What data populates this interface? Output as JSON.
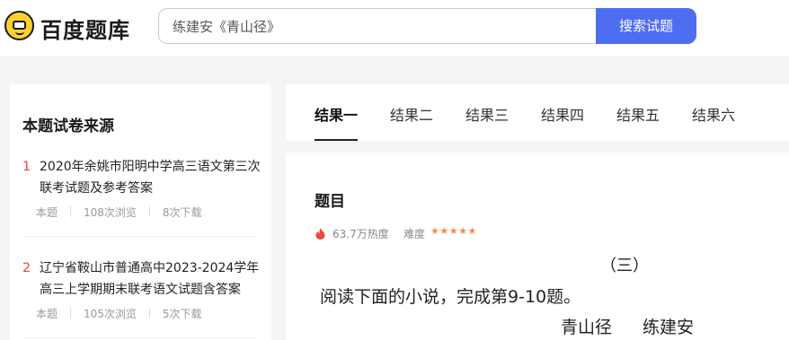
{
  "header": {
    "logo_text": "百度题库",
    "search_value": "练建安《青山径》",
    "search_button": "搜索试题"
  },
  "sidebar": {
    "title": "本题试卷来源",
    "items": [
      {
        "num": "1",
        "title": "2020年余姚市阳明中学高三语文第三次联考试题及参考答案",
        "tag": "本题",
        "views": "108次浏览",
        "downloads": "8次下载"
      },
      {
        "num": "2",
        "title": "辽宁省鞍山市普通高中2023-2024学年高三上学期期末联考语文试题含答案",
        "tag": "本题",
        "views": "105次浏览",
        "downloads": "5次下载"
      }
    ]
  },
  "tabs": [
    "结果一",
    "结果二",
    "结果三",
    "结果四",
    "结果五",
    "结果六"
  ],
  "question": {
    "heading": "题目",
    "heat": "63.7万热度",
    "difficulty_label": "难度",
    "stars": "★★★★★",
    "difficulty_stars": 5,
    "section": "（三）",
    "instruction": "阅读下面的小说，完成第9-10题。",
    "story_title": "青山径",
    "author": "练建安"
  },
  "colors": {
    "accent": "#4e6ef2",
    "number_red": "#e0473c",
    "star_orange": "#f28b46",
    "logo_yellow": "#ffd22e"
  },
  "icons": {
    "logo": "bear-logo-icon",
    "heat": "fire-icon",
    "difficulty": "star-icon"
  }
}
